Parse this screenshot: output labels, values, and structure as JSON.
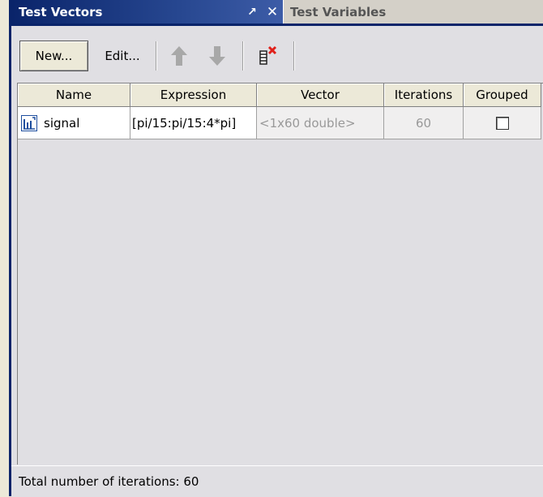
{
  "panel": {
    "active_tab": "Test Vectors",
    "inactive_tab": "Test Variables",
    "undock_glyph": "↗",
    "close_glyph": "✕"
  },
  "toolbar": {
    "new_label": "New...",
    "edit_label": "Edit...",
    "icons": [
      "up-arrow-icon",
      "down-arrow-icon",
      "delete-vector-icon"
    ]
  },
  "table": {
    "columns": [
      "Name",
      "Expression",
      "Vector",
      "Iterations",
      "Grouped"
    ],
    "rows": [
      {
        "name": "signal",
        "expression": "[pi/15:pi/15:4*pi]",
        "vector": "<1x60 double>",
        "iterations": "60",
        "grouped": false
      }
    ]
  },
  "status": {
    "text": "Total number of iterations: 60"
  },
  "colors": {
    "title_bar": "#0a246a",
    "disabled_arrow": "#a8a8a8",
    "delete_x": "#e0201a"
  }
}
